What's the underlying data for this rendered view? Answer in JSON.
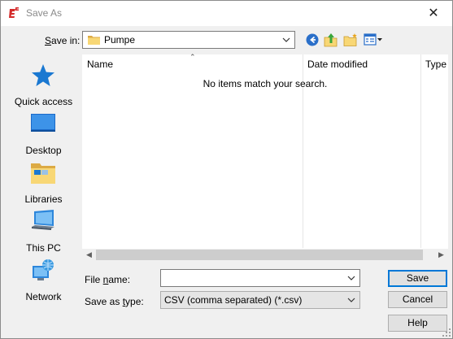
{
  "window": {
    "title": "Save As",
    "close_glyph": "✕"
  },
  "save_in": {
    "label": "Save in:",
    "value": "Pumpe"
  },
  "toolbar": {
    "icons": [
      "back-icon",
      "up-folder-icon",
      "new-folder-icon",
      "view-menu-icon"
    ]
  },
  "places": [
    {
      "label": "Quick access",
      "icon": "quick-access-star-icon"
    },
    {
      "label": "Desktop",
      "icon": "desktop-icon"
    },
    {
      "label": "Libraries",
      "icon": "libraries-icon"
    },
    {
      "label": "This PC",
      "icon": "this-pc-icon"
    },
    {
      "label": "Network",
      "icon": "network-icon"
    }
  ],
  "file_list": {
    "columns": [
      "Name",
      "Date modified",
      "Type"
    ],
    "empty_message": "No items match your search."
  },
  "file_name": {
    "label": "File name:",
    "value": ""
  },
  "save_as_type": {
    "label": "Save as type:",
    "value": "CSV (comma separated) (*.csv)"
  },
  "buttons": {
    "save": "Save",
    "cancel": "Cancel",
    "help": "Help"
  },
  "colors": {
    "accent": "#0078d7",
    "folder": "#f8d775",
    "title_text": "#8a8a8a"
  }
}
